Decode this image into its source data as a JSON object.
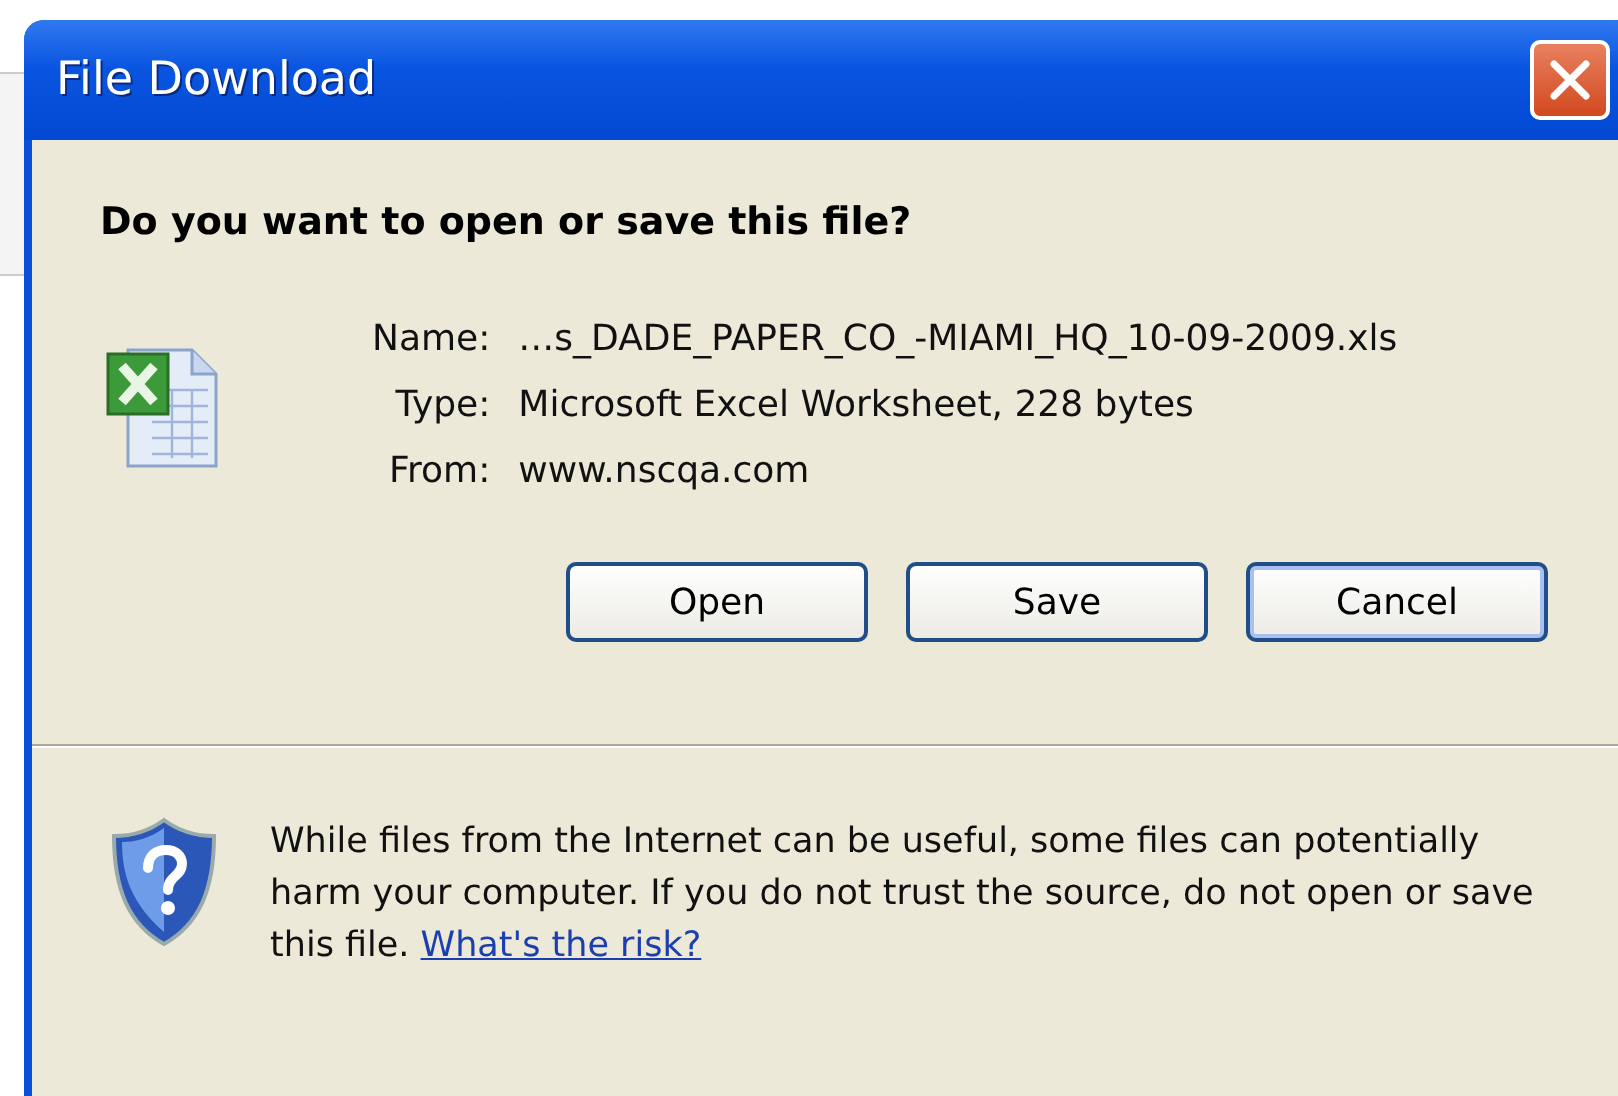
{
  "window": {
    "title": "File Download"
  },
  "question": "Do you want to open or save this file?",
  "details": [
    {
      "label": "Name:",
      "value": "…s_DADE_PAPER_CO_-MIAMI_HQ_10-09-2009.xls"
    },
    {
      "label": "Type:",
      "value": "Microsoft Excel Worksheet, 228 bytes"
    },
    {
      "label": "From:",
      "value": "www.nscqa.com"
    }
  ],
  "buttons": [
    {
      "label": "Open",
      "default": false
    },
    {
      "label": "Save",
      "default": false
    },
    {
      "label": "Cancel",
      "default": true
    }
  ],
  "warning": {
    "text": "While files from the Internet can be useful, some files can potentially harm your computer. If you do not trust the source, do not open or save this file.",
    "link": "What's the risk?"
  }
}
